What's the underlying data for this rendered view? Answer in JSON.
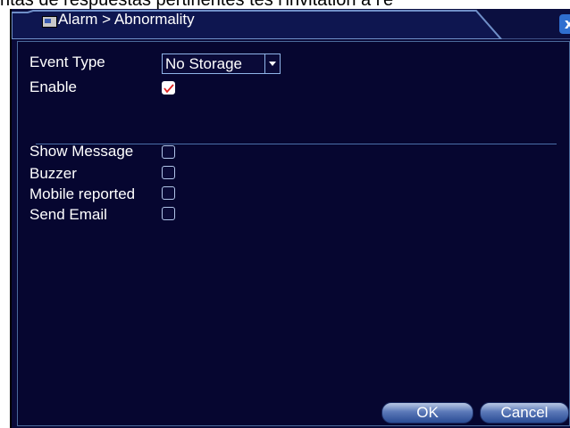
{
  "background": {
    "text": "ntas de respuestas pertinentes tes l'invitation à l'é"
  },
  "window": {
    "title_path": "Alarm > Abnormality",
    "close_label": "x"
  },
  "form": {
    "event_type_label": "Event Type",
    "event_type_value": "No Storage",
    "enable_label": "Enable",
    "enable_checked": true
  },
  "actions": [
    {
      "label": "Show Message",
      "checked": false
    },
    {
      "label": "Buzzer",
      "checked": false
    },
    {
      "label": "Mobile reported",
      "checked": false
    },
    {
      "label": "Send Email",
      "checked": false
    }
  ],
  "buttons": {
    "ok": "OK",
    "cancel": "Cancel"
  },
  "colors": {
    "window_bg": "#0a0a38",
    "accent": "#2f6fd0",
    "check_mark": "#e02020"
  }
}
